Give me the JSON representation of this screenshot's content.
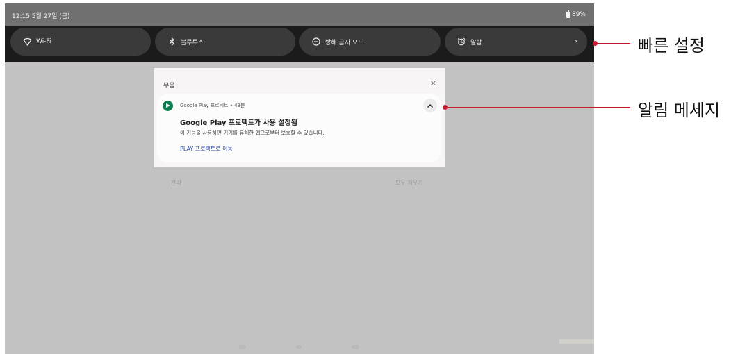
{
  "status_bar": {
    "time": "12:15 5월 27일 (금)",
    "battery": "89%"
  },
  "quick_settings": {
    "tiles": [
      {
        "label": "Wi-Fi",
        "icon": "wifi-icon"
      },
      {
        "label": "블루투스",
        "icon": "bluetooth-icon"
      },
      {
        "label": "방해 금지 모드",
        "icon": "do-not-disturb-icon"
      },
      {
        "label": "알람",
        "icon": "alarm-icon"
      }
    ]
  },
  "notification_panel": {
    "section_title": "무음",
    "close_symbol": "×",
    "notification": {
      "app_meta": "Google Play 프로텍트 • 43분",
      "title": "Google Play 프로텍트가 사용 설정됨",
      "body": "이 기능을 사용하면 기기를 유해한 앱으로부터 보호할 수 있습니다.",
      "action": "PLAY 프로텍트로 이동"
    },
    "manage_label": "관리",
    "clear_all_label": "모두 지우기"
  },
  "annotations": {
    "quick_settings": "빠른 설정",
    "notification": "알림 메세지"
  },
  "colors": {
    "accent_annotation": "#c21a2e",
    "app_icon": "#0f7c4e",
    "action_link": "#2b4aa6"
  }
}
